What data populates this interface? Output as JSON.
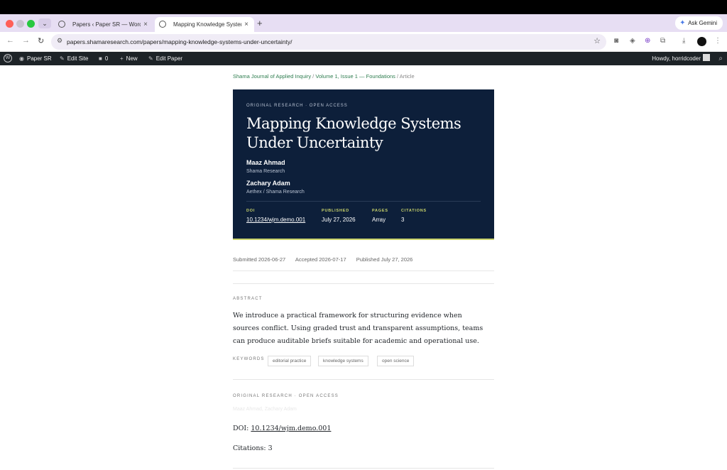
{
  "browser": {
    "tabs": [
      {
        "title": "Papers ‹ Paper SR — WordPress",
        "active": false
      },
      {
        "title": "Mapping Knowledge Systems Under Uncertainty",
        "active": true
      }
    ],
    "new_tab": "+",
    "close_glyph": "×",
    "ask_gemini": "Ask Gemini",
    "url": "papers.shamaresearch.com/papers/mapping-knowledge-systems-under-uncertainty/"
  },
  "wp_admin_bar": {
    "site": "Paper SR",
    "edit_site": "Edit Site",
    "comments_count": "0",
    "new": "New",
    "edit_paper": "Edit Paper",
    "howdy": "Howdy, horridcoder"
  },
  "breadcrumb": {
    "journal": "Shama Journal of Applied Inquiry",
    "issue": "Volume 1, Issue 1 — Foundations",
    "current": "Article",
    "sep": "/"
  },
  "hero": {
    "kicker": "ORIGINAL RESEARCH · OPEN ACCESS",
    "title": "Mapping Knowledge Systems Under Uncertainty",
    "authors": [
      {
        "name": "Maaz Ahmad",
        "affiliation": "Shama Research"
      },
      {
        "name": "Zachary Adam",
        "affiliation": "Aethex / Shama Research"
      }
    ],
    "meta": {
      "doi_label": "DOI",
      "doi": "10.1234/wjm.demo.001",
      "published_label": "PUBLISHED",
      "published": "July 27, 2026",
      "pages_label": "PAGES",
      "pages": "Array",
      "citations_label": "CITATIONS",
      "citations": "3"
    },
    "accent_color": "#c9d36a",
    "bg_color": "#0d1f3a"
  },
  "dates": {
    "submitted": "Submitted 2026-06-27",
    "accepted": "Accepted 2026-07-17",
    "published": "Published July 27, 2026"
  },
  "abstract": {
    "label": "ABSTRACT",
    "text": "We introduce a practical framework for structuring evidence when sources conflict. Using graded trust and transparent assumptions, teams can produce auditable briefs suitable for academic and operational use."
  },
  "keywords": {
    "label": "KEYWORDS",
    "items": [
      "editorial practice",
      "knowledge systems",
      "open science"
    ]
  },
  "footer_section": {
    "kicker": "ORIGINAL RESEARCH · OPEN ACCESS",
    "faded_authors": "Maaz Ahmad, Zachary Adam",
    "doi_label": "DOI:",
    "doi": "10.1234/wjm.demo.001",
    "citations": "Citations: 3"
  }
}
